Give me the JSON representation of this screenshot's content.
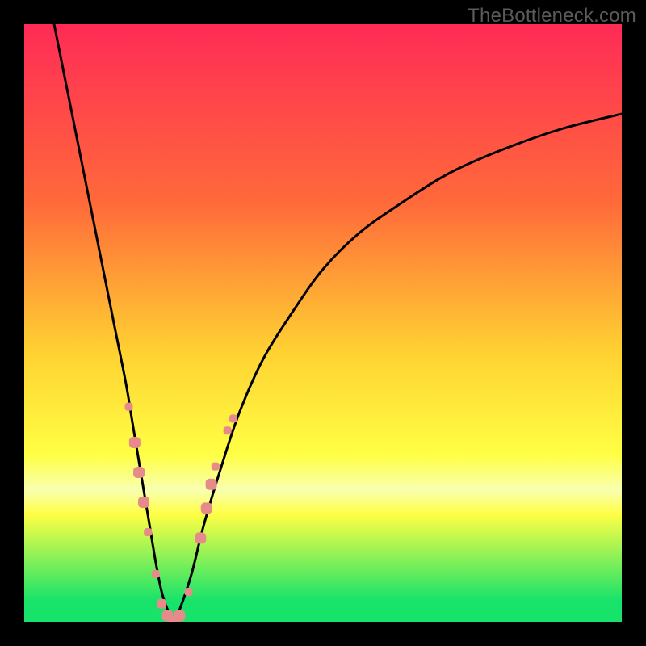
{
  "watermark": "TheBottleneck.com",
  "colors": {
    "frame": "#000000",
    "gradient_top": "#ff2b56",
    "gradient_mid_upper": "#ff6a3a",
    "gradient_mid": "#ffd232",
    "gradient_mid_lower": "#ffff44",
    "gradient_lower_band": "#f8ffb0",
    "gradient_green": "#17e36a",
    "curve_stroke": "#000000",
    "marker_fill": "#e78a8a"
  },
  "chart_data": {
    "type": "line",
    "title": "",
    "xlabel": "",
    "ylabel": "",
    "xlim": [
      0,
      100
    ],
    "ylim": [
      0,
      100
    ],
    "series": [
      {
        "name": "bottleneck-curve",
        "x": [
          5,
          7,
          9,
          11,
          13,
          15,
          17,
          18,
          19,
          20,
          21,
          22,
          23,
          24,
          25,
          26,
          28,
          30,
          33,
          36,
          40,
          45,
          50,
          56,
          63,
          71,
          80,
          90,
          100
        ],
        "y": [
          100,
          90,
          80,
          70,
          60,
          50,
          40,
          34,
          28,
          22,
          16,
          10,
          5,
          2,
          0,
          2,
          8,
          16,
          26,
          35,
          44,
          52,
          59,
          65,
          70,
          75,
          79,
          82.5,
          85
        ]
      }
    ],
    "markers": [
      {
        "x": 17.5,
        "y": 36,
        "size": 10
      },
      {
        "x": 18.5,
        "y": 30,
        "size": 14
      },
      {
        "x": 19.2,
        "y": 25,
        "size": 14
      },
      {
        "x": 20.0,
        "y": 20,
        "size": 14
      },
      {
        "x": 20.7,
        "y": 15,
        "size": 10
      },
      {
        "x": 22.0,
        "y": 8,
        "size": 10
      },
      {
        "x": 23.0,
        "y": 3,
        "size": 12
      },
      {
        "x": 24.0,
        "y": 1,
        "size": 14
      },
      {
        "x": 25.0,
        "y": 0,
        "size": 14
      },
      {
        "x": 26.0,
        "y": 1,
        "size": 14
      },
      {
        "x": 27.5,
        "y": 5,
        "size": 10
      },
      {
        "x": 29.5,
        "y": 14,
        "size": 14
      },
      {
        "x": 30.5,
        "y": 19,
        "size": 14
      },
      {
        "x": 31.3,
        "y": 23,
        "size": 14
      },
      {
        "x": 32.0,
        "y": 26,
        "size": 10
      },
      {
        "x": 34.0,
        "y": 32,
        "size": 10
      },
      {
        "x": 35.0,
        "y": 34,
        "size": 10
      }
    ],
    "gradient_stops": [
      {
        "offset": 0.0,
        "key": "gradient_top"
      },
      {
        "offset": 0.3,
        "key": "gradient_mid_upper"
      },
      {
        "offset": 0.55,
        "key": "gradient_mid"
      },
      {
        "offset": 0.72,
        "key": "gradient_mid_lower"
      },
      {
        "offset": 0.78,
        "key": "gradient_lower_band"
      },
      {
        "offset": 0.82,
        "key": "gradient_mid_lower"
      },
      {
        "offset": 0.965,
        "key": "gradient_green"
      },
      {
        "offset": 1.0,
        "key": "gradient_green"
      }
    ]
  }
}
